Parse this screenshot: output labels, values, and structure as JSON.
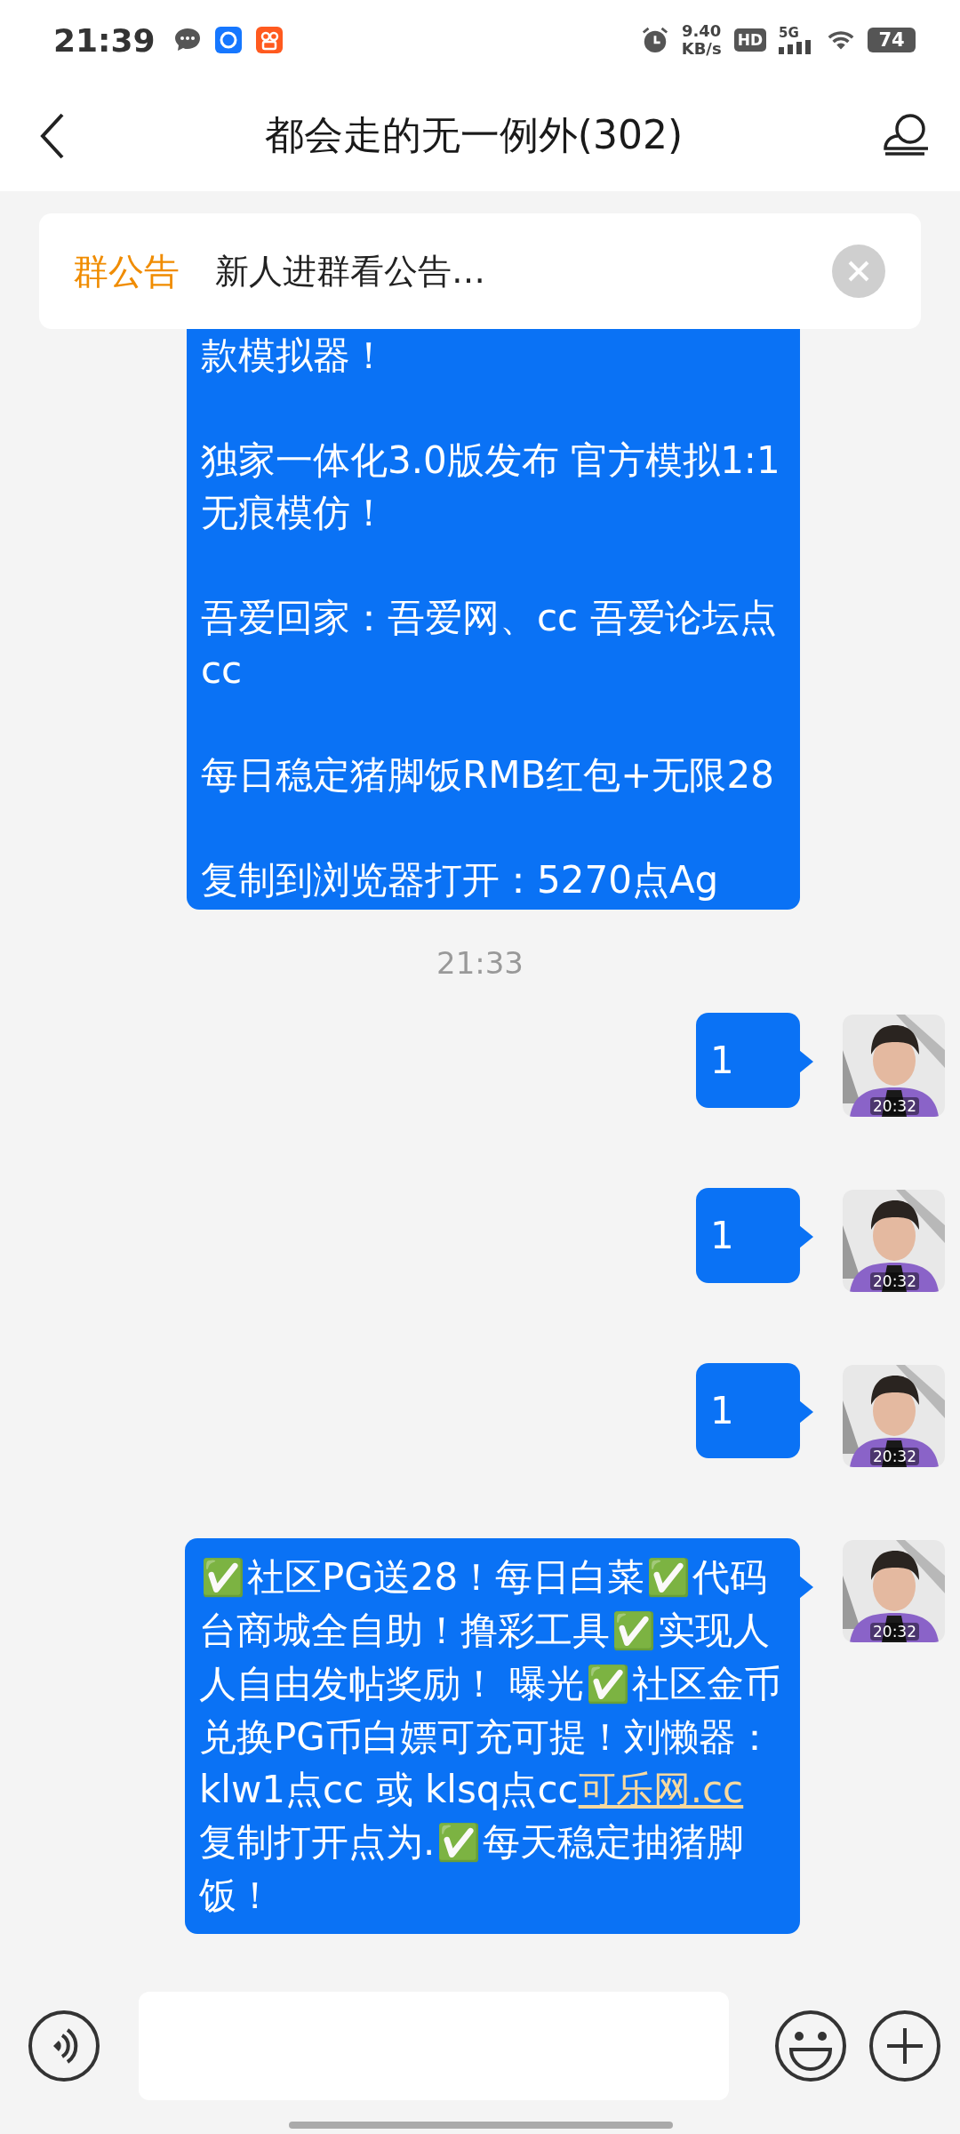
{
  "status_bar": {
    "time": "21:39",
    "notifications": [
      {
        "kind": "chat"
      },
      {
        "kind": "blue-app"
      },
      {
        "kind": "orange-app"
      }
    ],
    "net_speed": "9.40",
    "net_unit": "KB/s",
    "hd": "HD",
    "network": "5G",
    "battery": "74"
  },
  "header": {
    "title": "都会走的无一例外(302)"
  },
  "notice": {
    "label": "群公告",
    "text": "新人进群看公告…"
  },
  "messages": [
    {
      "kind": "bubble",
      "paragraphs": [
        "款模拟器！",
        "独家一体化3.0版发布 官方模拟1:1无痕模仿！",
        "吾爱回家：吾爱网、cc  吾爱论坛点cc",
        "每日稳定猪脚饭RMB红包+无限28",
        "复制到浏览器打开：5270点Ag"
      ]
    },
    {
      "kind": "time",
      "text": "21:33"
    },
    {
      "kind": "bubble",
      "avatar_time": "20:32",
      "paragraphs": [
        "1"
      ]
    },
    {
      "kind": "bubble",
      "avatar_time": "20:32",
      "paragraphs": [
        "1"
      ]
    },
    {
      "kind": "bubble",
      "avatar_time": "20:32",
      "paragraphs": [
        "1"
      ]
    },
    {
      "kind": "rich",
      "avatar_time": "20:32",
      "segments": [
        {
          "kind": "emoji",
          "text": "✅"
        },
        {
          "kind": "text",
          "text": "社区PG送28！每日白菜"
        },
        {
          "kind": "emoji",
          "text": "✅"
        },
        {
          "kind": "text",
          "text": "代码台商城全自助！撸彩工具"
        },
        {
          "kind": "emoji",
          "text": "✅"
        },
        {
          "kind": "text",
          "text": "实现人人自由发帖奖励！ 曝光"
        },
        {
          "kind": "emoji",
          "text": "✅"
        },
        {
          "kind": "text",
          "text": "社区金币兑换PG币白嫖可充可提！刘懒器： klw1点cc 或 klsq点cc"
        },
        {
          "kind": "link",
          "text": "可乐网.cc"
        },
        {
          "kind": "text",
          "text": " 复制打开点为."
        },
        {
          "kind": "emoji",
          "text": "✅"
        },
        {
          "kind": "text",
          "text": "每天稳定抽猪脚饭！"
        }
      ]
    }
  ],
  "composer": {
    "buttons": [
      {
        "kind": "voice"
      }
    ],
    "actions": [
      {
        "kind": "emoji"
      },
      {
        "kind": "plus"
      }
    ]
  }
}
